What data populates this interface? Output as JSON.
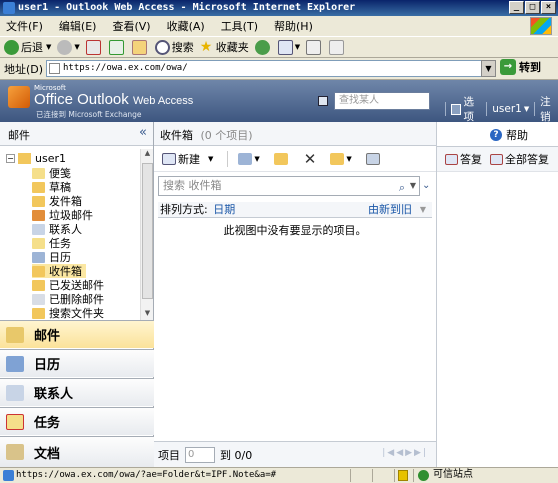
{
  "window": {
    "title": "user1 - Outlook Web Access - Microsoft Internet Explorer",
    "buttons": [
      "_",
      "□",
      "×"
    ]
  },
  "menu": [
    "文件(F)",
    "编辑(E)",
    "查看(V)",
    "收藏(A)",
    "工具(T)",
    "帮助(H)"
  ],
  "toolbar": {
    "back": "后退",
    "search": "搜索",
    "favorites": "收藏夹"
  },
  "address": {
    "label": "地址(D)",
    "url": "https://owa.ex.com/owa/",
    "go": "转到"
  },
  "owa": {
    "ms": "Microsoft",
    "product_a": "Office Outlook",
    "product_b": "Web Access",
    "connected": "已连接到 Microsoft Exchange",
    "find_placeholder": "查找某人",
    "options": "选项",
    "user": "user1",
    "logout": "注销"
  },
  "left": {
    "title": "邮件",
    "collapse": "«",
    "root": "user1",
    "folders": [
      "便笺",
      "草稿",
      "发件箱",
      "垃圾邮件",
      "联系人",
      "任务",
      "日历",
      "收件箱",
      "已发送邮件",
      "已删除邮件",
      "搜索文件夹"
    ],
    "nav": [
      "邮件",
      "日历",
      "联系人",
      "任务",
      "文档"
    ]
  },
  "mid": {
    "title": "收件箱",
    "count": "(0 个项目)",
    "new_label": "新建",
    "search_placeholder": "搜索 收件箱",
    "sort_label": "排列方式:",
    "sort_value": "日期",
    "sort_order": "由新到旧",
    "empty_msg": "此视图中没有要显示的项目。",
    "pager_label": "项目",
    "pager_value": "0",
    "pager_to": "到 0/0"
  },
  "right": {
    "help": "帮助",
    "reply": "答复",
    "reply_all": "全部答复"
  },
  "status": {
    "url": "https://owa.ex.com/owa/?ae=Folder&t=IPF.Note&a=#",
    "zone": "可信站点"
  }
}
